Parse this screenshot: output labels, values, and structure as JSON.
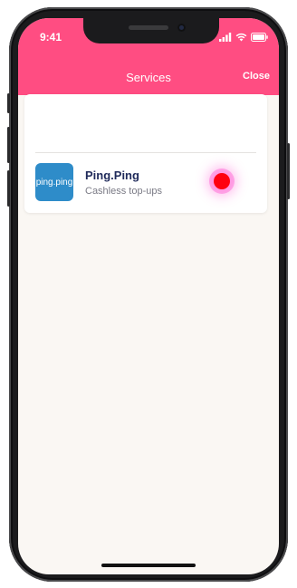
{
  "status_bar": {
    "time": "9:41"
  },
  "nav": {
    "title": "Services",
    "close_label": "Close"
  },
  "services": [
    {
      "logo_text": "ping.ping",
      "name": "Ping.Ping",
      "description": "Cashless top-ups",
      "icon": "ping-ping-logo"
    }
  ],
  "colors": {
    "header": "#ff4d82",
    "background": "#faf7f3",
    "logo": "#2e8cc9",
    "touch_indicator": "#ff0010"
  }
}
